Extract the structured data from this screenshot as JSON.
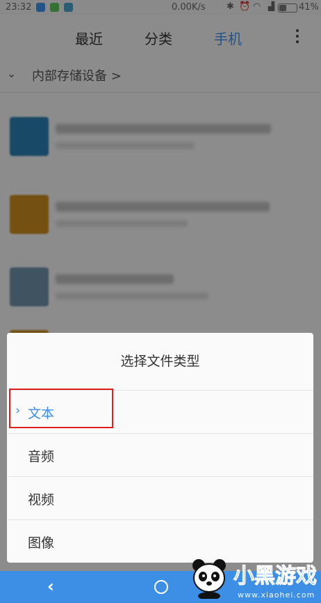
{
  "status_bar": {
    "time": "23:32",
    "network_speed": "0.00K/s",
    "battery_percent": "41%",
    "battery_level": 0.41
  },
  "tabs": [
    {
      "label": "最近",
      "active": false
    },
    {
      "label": "分类",
      "active": false
    },
    {
      "label": "手机",
      "active": true
    }
  ],
  "breadcrumb": {
    "path": "内部存储设备 >"
  },
  "dialog": {
    "title": "选择文件类型",
    "options": [
      {
        "label": "文本",
        "selected": true
      },
      {
        "label": "音频",
        "selected": false
      },
      {
        "label": "视频",
        "selected": false
      },
      {
        "label": "图像",
        "selected": false
      }
    ]
  },
  "watermark": {
    "brand": "小黑游戏",
    "url": "www.xiaohei.com"
  },
  "colors": {
    "accent": "#3d8fe6",
    "highlight_box": "#e02020"
  },
  "icons": [
    "notification-icon",
    "wechat-icon",
    "bluetooth-icon",
    "alarm-icon",
    "wifi-icon",
    "signal-icon",
    "battery-icon",
    "more-vert-icon",
    "chevron-down-icon",
    "chevron-right-icon",
    "back-icon",
    "home-icon"
  ]
}
